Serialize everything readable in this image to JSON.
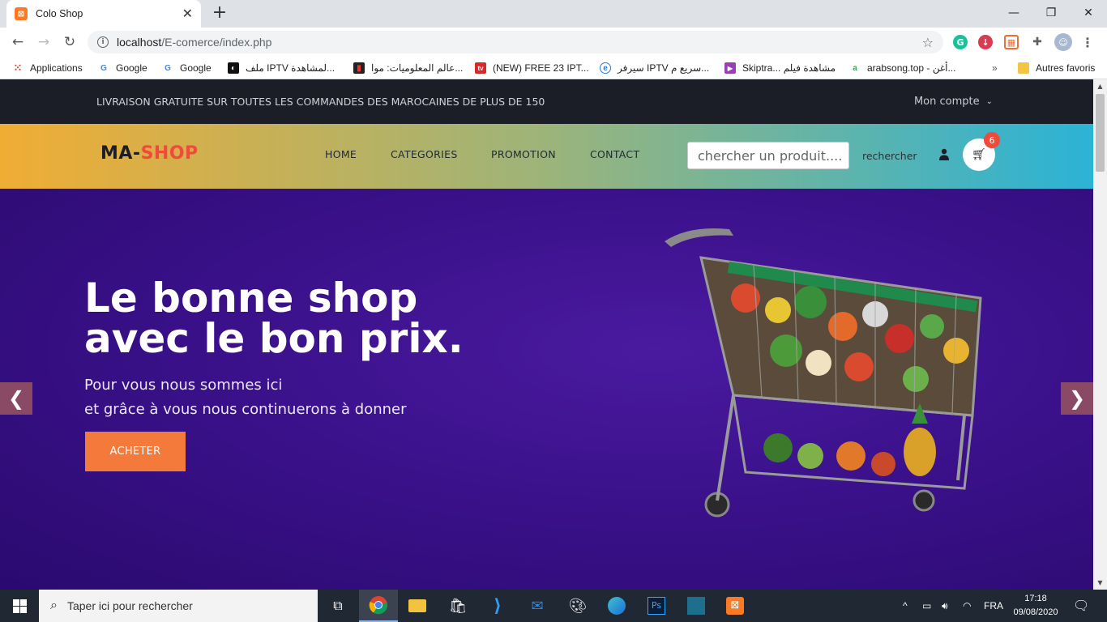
{
  "browser": {
    "tab_title": "Colo Shop",
    "url_host": "localhost",
    "url_path": "/E-comerce/index.php"
  },
  "bookmarks": [
    {
      "label": "Applications",
      "icon": "apps-grid-icon"
    },
    {
      "label": "Google",
      "icon": "google-icon"
    },
    {
      "label": "Google",
      "icon": "google-icon"
    },
    {
      "label": "ملف IPTV لمشاهدة...",
      "icon": "iptv-icon"
    },
    {
      "label": "عالم المعلوميات: موا...",
      "icon": "blog-icon"
    },
    {
      "label": "(NEW) FREE 23 IPT...",
      "icon": "tv-icon"
    },
    {
      "label": "سيرفر IPTV سريع م...",
      "icon": "server-icon"
    },
    {
      "label": "Skiptra... مشاهدة فيلم",
      "icon": "video-icon"
    },
    {
      "label": "arabsong.top - أغن...",
      "icon": "music-icon"
    },
    {
      "label": "Autres favoris",
      "icon": "folder-icon"
    }
  ],
  "site": {
    "topbar_text": "LIVRAISON GRATUITE SUR TOUTES LES COMMANDES DES MAROCAINES DE PLUS DE 150",
    "account_label": "Mon compte",
    "logo_part1": "MA-",
    "logo_part2": "SHOP",
    "nav": [
      "HOME",
      "CATEGORIES",
      "PROMOTION",
      "CONTACT"
    ],
    "search_placeholder": "chercher un produit....",
    "search_button": "rechercher",
    "cart_count": "6",
    "hero_title_line1": "Le bonne shop",
    "hero_title_line2": "avec le bon prix.",
    "hero_sub_line1": "Pour vous nous sommes ici",
    "hero_sub_line2": "et grâce à vous nous continuerons à donner",
    "buy_button": "ACHETER"
  },
  "taskbar": {
    "search_placeholder": "Taper ici pour rechercher",
    "language": "FRA",
    "time": "17:18",
    "date": "09/08/2020"
  },
  "colors": {
    "topbar_bg": "#1b1e26",
    "logo_accent": "#f04a3b",
    "hero_bg": "#3b118b",
    "buy_button": "#f37a3a"
  }
}
